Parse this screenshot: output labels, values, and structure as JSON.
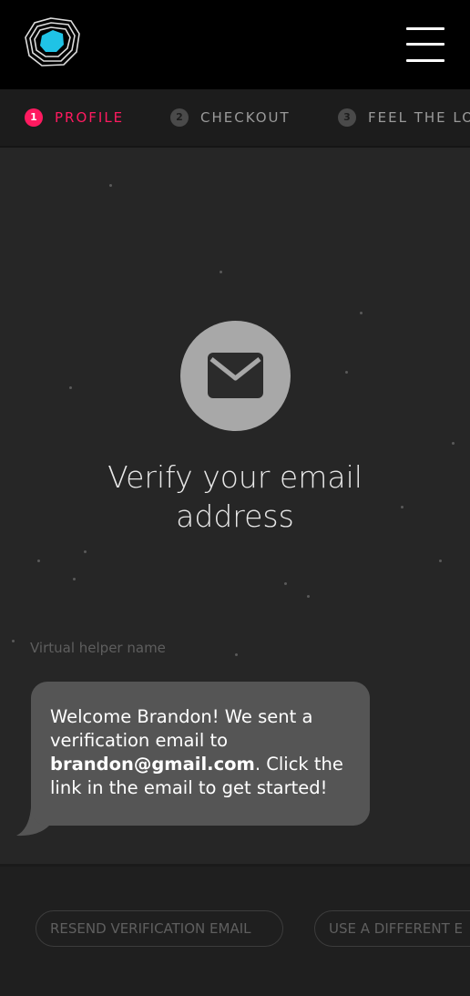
{
  "steps": [
    {
      "num": "1",
      "label": "PROFILE"
    },
    {
      "num": "2",
      "label": "CHECKOUT"
    },
    {
      "num": "3",
      "label": "FEEL THE LO"
    }
  ],
  "title_line1": "Verify your email",
  "title_line2": "address",
  "helper_name": "Virtual helper name",
  "message": {
    "part1": "Welcome Brandon! We sent a verification email to ",
    "email": "brandon@gmail.com",
    "part2": ". Click the link in the email to get started!"
  },
  "buttons": {
    "resend": "RESEND VERIFICATION EMAIL",
    "different": "USE A DIFFERENT E"
  },
  "colors": {
    "accent": "#ff1a60",
    "logo_fill": "#1fc3e6"
  },
  "icons": [
    "logo-icon",
    "hamburger-menu-icon",
    "mail-icon"
  ]
}
